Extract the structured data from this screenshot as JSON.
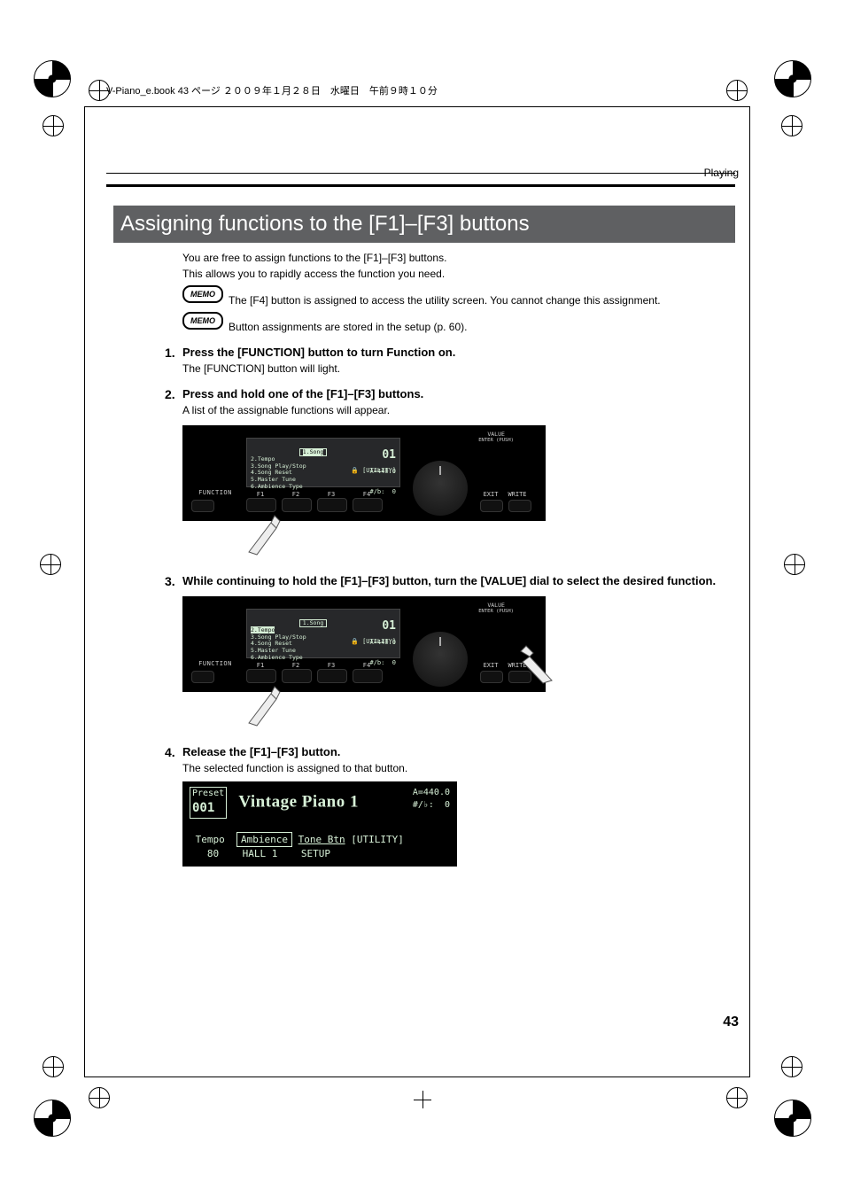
{
  "page": {
    "header_file": "V-Piano_e.book  43 ページ  ２００９年１月２８日　水曜日　午前９時１０分",
    "breadcrumb": "Playing",
    "section_title": "Assigning functions to the [F1]–[F3] buttons",
    "intro_1": "You are free to assign functions to the [F1]–[F3] buttons.",
    "intro_2": "This allows you to rapidly access the function you need.",
    "memo_label": "MEMO",
    "memo_1": "The [F4] button is assigned to access the utility screen. You cannot change this assignment.",
    "memo_2": "Button assignments are stored in the setup (p. 60).",
    "page_number": "43"
  },
  "steps": [
    {
      "num": "1.",
      "title": "Press the [FUNCTION] button to turn Function on.",
      "body": "The [FUNCTION] button will light."
    },
    {
      "num": "2.",
      "title": "Press and hold one of the [F1]–[F3] buttons.",
      "body": "A list of the assignable functions will appear."
    },
    {
      "num": "3.",
      "title": "While continuing to hold the [F1]–[F3] button, turn the [VALUE] dial to select the desired function.",
      "body": ""
    },
    {
      "num": "4.",
      "title": "Release the [F1]–[F3] button.",
      "body": "The selected function is assigned to that button."
    }
  ],
  "panel": {
    "function_label": "FUNCTION",
    "value_label_1": "VALUE",
    "value_label_2": "ENTER (PUSH)",
    "f_labels": [
      "F1",
      "F2",
      "F3",
      "F4"
    ],
    "exit_label": "EXIT",
    "write_label": "WRITE",
    "lcd_big": "01",
    "lcd_tune": "A=440.0",
    "lcd_trans": "#/b:  0",
    "lcd_util": "[UTILITY]",
    "lcd_lock_icon": "🔒",
    "list": {
      "items": [
        "1.Song",
        "2.Tempo",
        "3.Song Play/Stop",
        "4.Song Reset",
        "5.Master Tune",
        "6.Ambience Type"
      ],
      "highlight_step2": 0,
      "highlight_step3": 1
    }
  },
  "ext_lcd": {
    "preset_label": "Preset",
    "preset_num": "001",
    "tone_name": "Vintage Piano 1",
    "tune": "A=440.0",
    "trans": "#/♭:  0",
    "row2": {
      "tempo_label": "Tempo",
      "tempo_val": "80",
      "ambience_label": "Ambience",
      "ambience_val": "HALL 1",
      "tonebtn_label": "Tone Btn",
      "tonebtn_val": "SETUP",
      "utility": "[UTILITY]"
    }
  }
}
